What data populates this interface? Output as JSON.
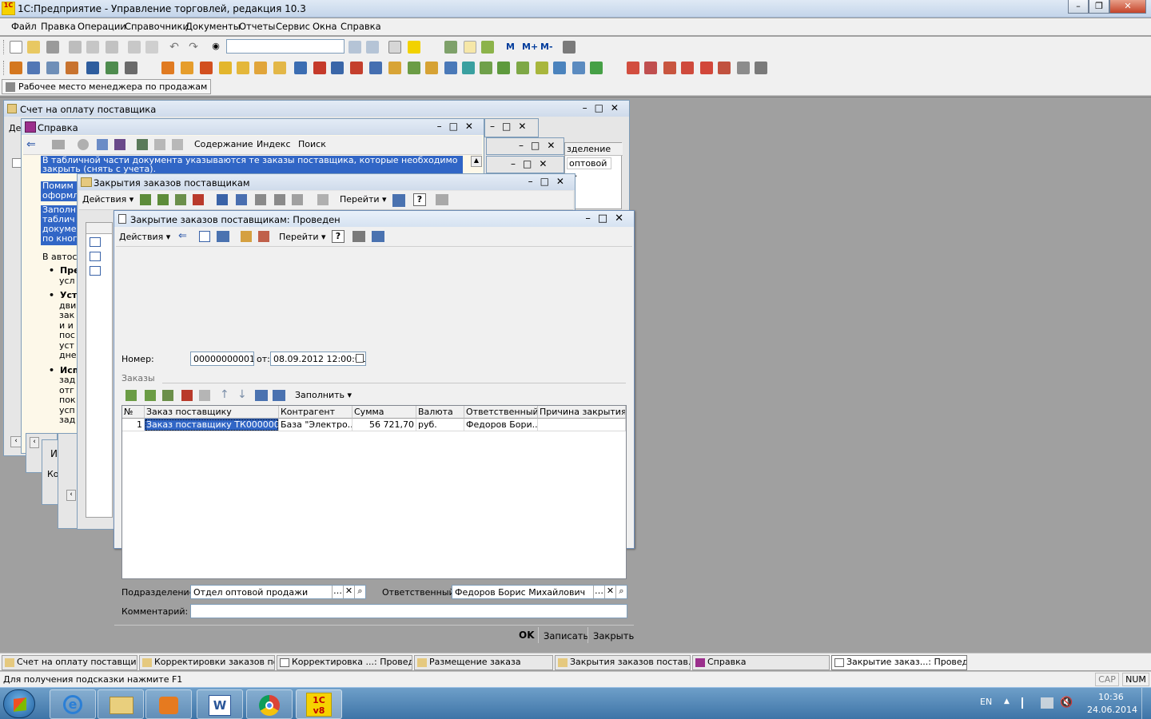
{
  "app": {
    "title": "1С:Предприятие - Управление торговлей, редакция 10.3",
    "icon_text": "1С"
  },
  "menu": [
    "Файл",
    "Правка",
    "Операции",
    "Справочники",
    "Документы",
    "Отчеты",
    "Сервис",
    "Окна",
    "Справка"
  ],
  "toolbar": {
    "search_value": "",
    "m_buttons": [
      "M",
      "M+",
      "M-"
    ]
  },
  "workspace_tab": "Рабочее место менеджера по продажам",
  "windows": {
    "invoice": {
      "title": "Счет на оплату поставщика",
      "partial_label": "Де"
    },
    "help": {
      "title": "Справка",
      "toolbar": {
        "contents": "Содержание",
        "index": "Индекс",
        "search": "Поиск"
      },
      "text_lines": [
        "В табличной части документа указываются те заказы поставщика, которые необходимо",
        "закрыть (снять с учета).",
        "Помим",
        "оформл",
        "Заполн",
        "таблич",
        "докуме",
        "по кноп",
        "В автос",
        "Пре",
        "усл",
        "Уст",
        "дви",
        "зак",
        "и и",
        "пос",
        "уст",
        "дне",
        "Исп",
        "зад",
        "отг",
        "пок",
        "усп",
        "зад"
      ]
    },
    "small_windows": {
      "column_header": "зделение",
      "cell": "оптовой ...",
      "partial1": "И",
      "partial2": "Ко"
    },
    "closing_list": {
      "title": "Закрытия заказов поставщикам",
      "actions": "Действия",
      "goto": "Перейти"
    },
    "closing_doc": {
      "title": "Закрытие заказов поставщикам: Проведен",
      "actions": "Действия",
      "goto": "Перейти",
      "number_label": "Номер:",
      "number_value": "00000000001",
      "date_label": "от:",
      "date_value": "08.09.2012 12:00:01",
      "section_label": "Заказы",
      "fill_button": "Заполнить",
      "columns": [
        "№",
        "Заказ поставщику",
        "Контрагент",
        "Сумма",
        "Валюта",
        "Ответственный",
        "Причина закрытия ..."
      ],
      "rows": [
        [
          "1",
          "Заказ поставщику ТК0000000...",
          "База \"Электро...",
          "56 721,70",
          "руб.",
          "Федоров Бори...",
          ""
        ]
      ],
      "department_label": "Подразделение:",
      "department_value": "Отдел оптовой продажи",
      "responsible_label": "Ответственный:",
      "responsible_value": "Федоров Борис Михайлович",
      "comment_label": "Комментарий:",
      "comment_value": "",
      "ok_button": "OK",
      "save_button": "Записать",
      "close_button": "Закрыть"
    }
  },
  "window_tabs": [
    "Счет на оплату поставщика",
    "Корректировки заказов по...",
    "Корректировка ...: Проведен",
    "Размещение заказа",
    "Закрытия заказов постав...",
    "Справка",
    "Закрытие заказ...: Проведен"
  ],
  "status": {
    "hint": "Для получения подсказки нажмите F1",
    "cap": "CAP",
    "num": "NUM"
  },
  "os_taskbar": {
    "lang": "EN",
    "time": "10:36",
    "date": "24.06.2014",
    "onec_label": "1С v8"
  },
  "colors": {
    "selection": "#3166c6",
    "mdi_background": "#a0a0a0",
    "taskbar": "#4f86bb",
    "accent_red": "#c00000"
  }
}
